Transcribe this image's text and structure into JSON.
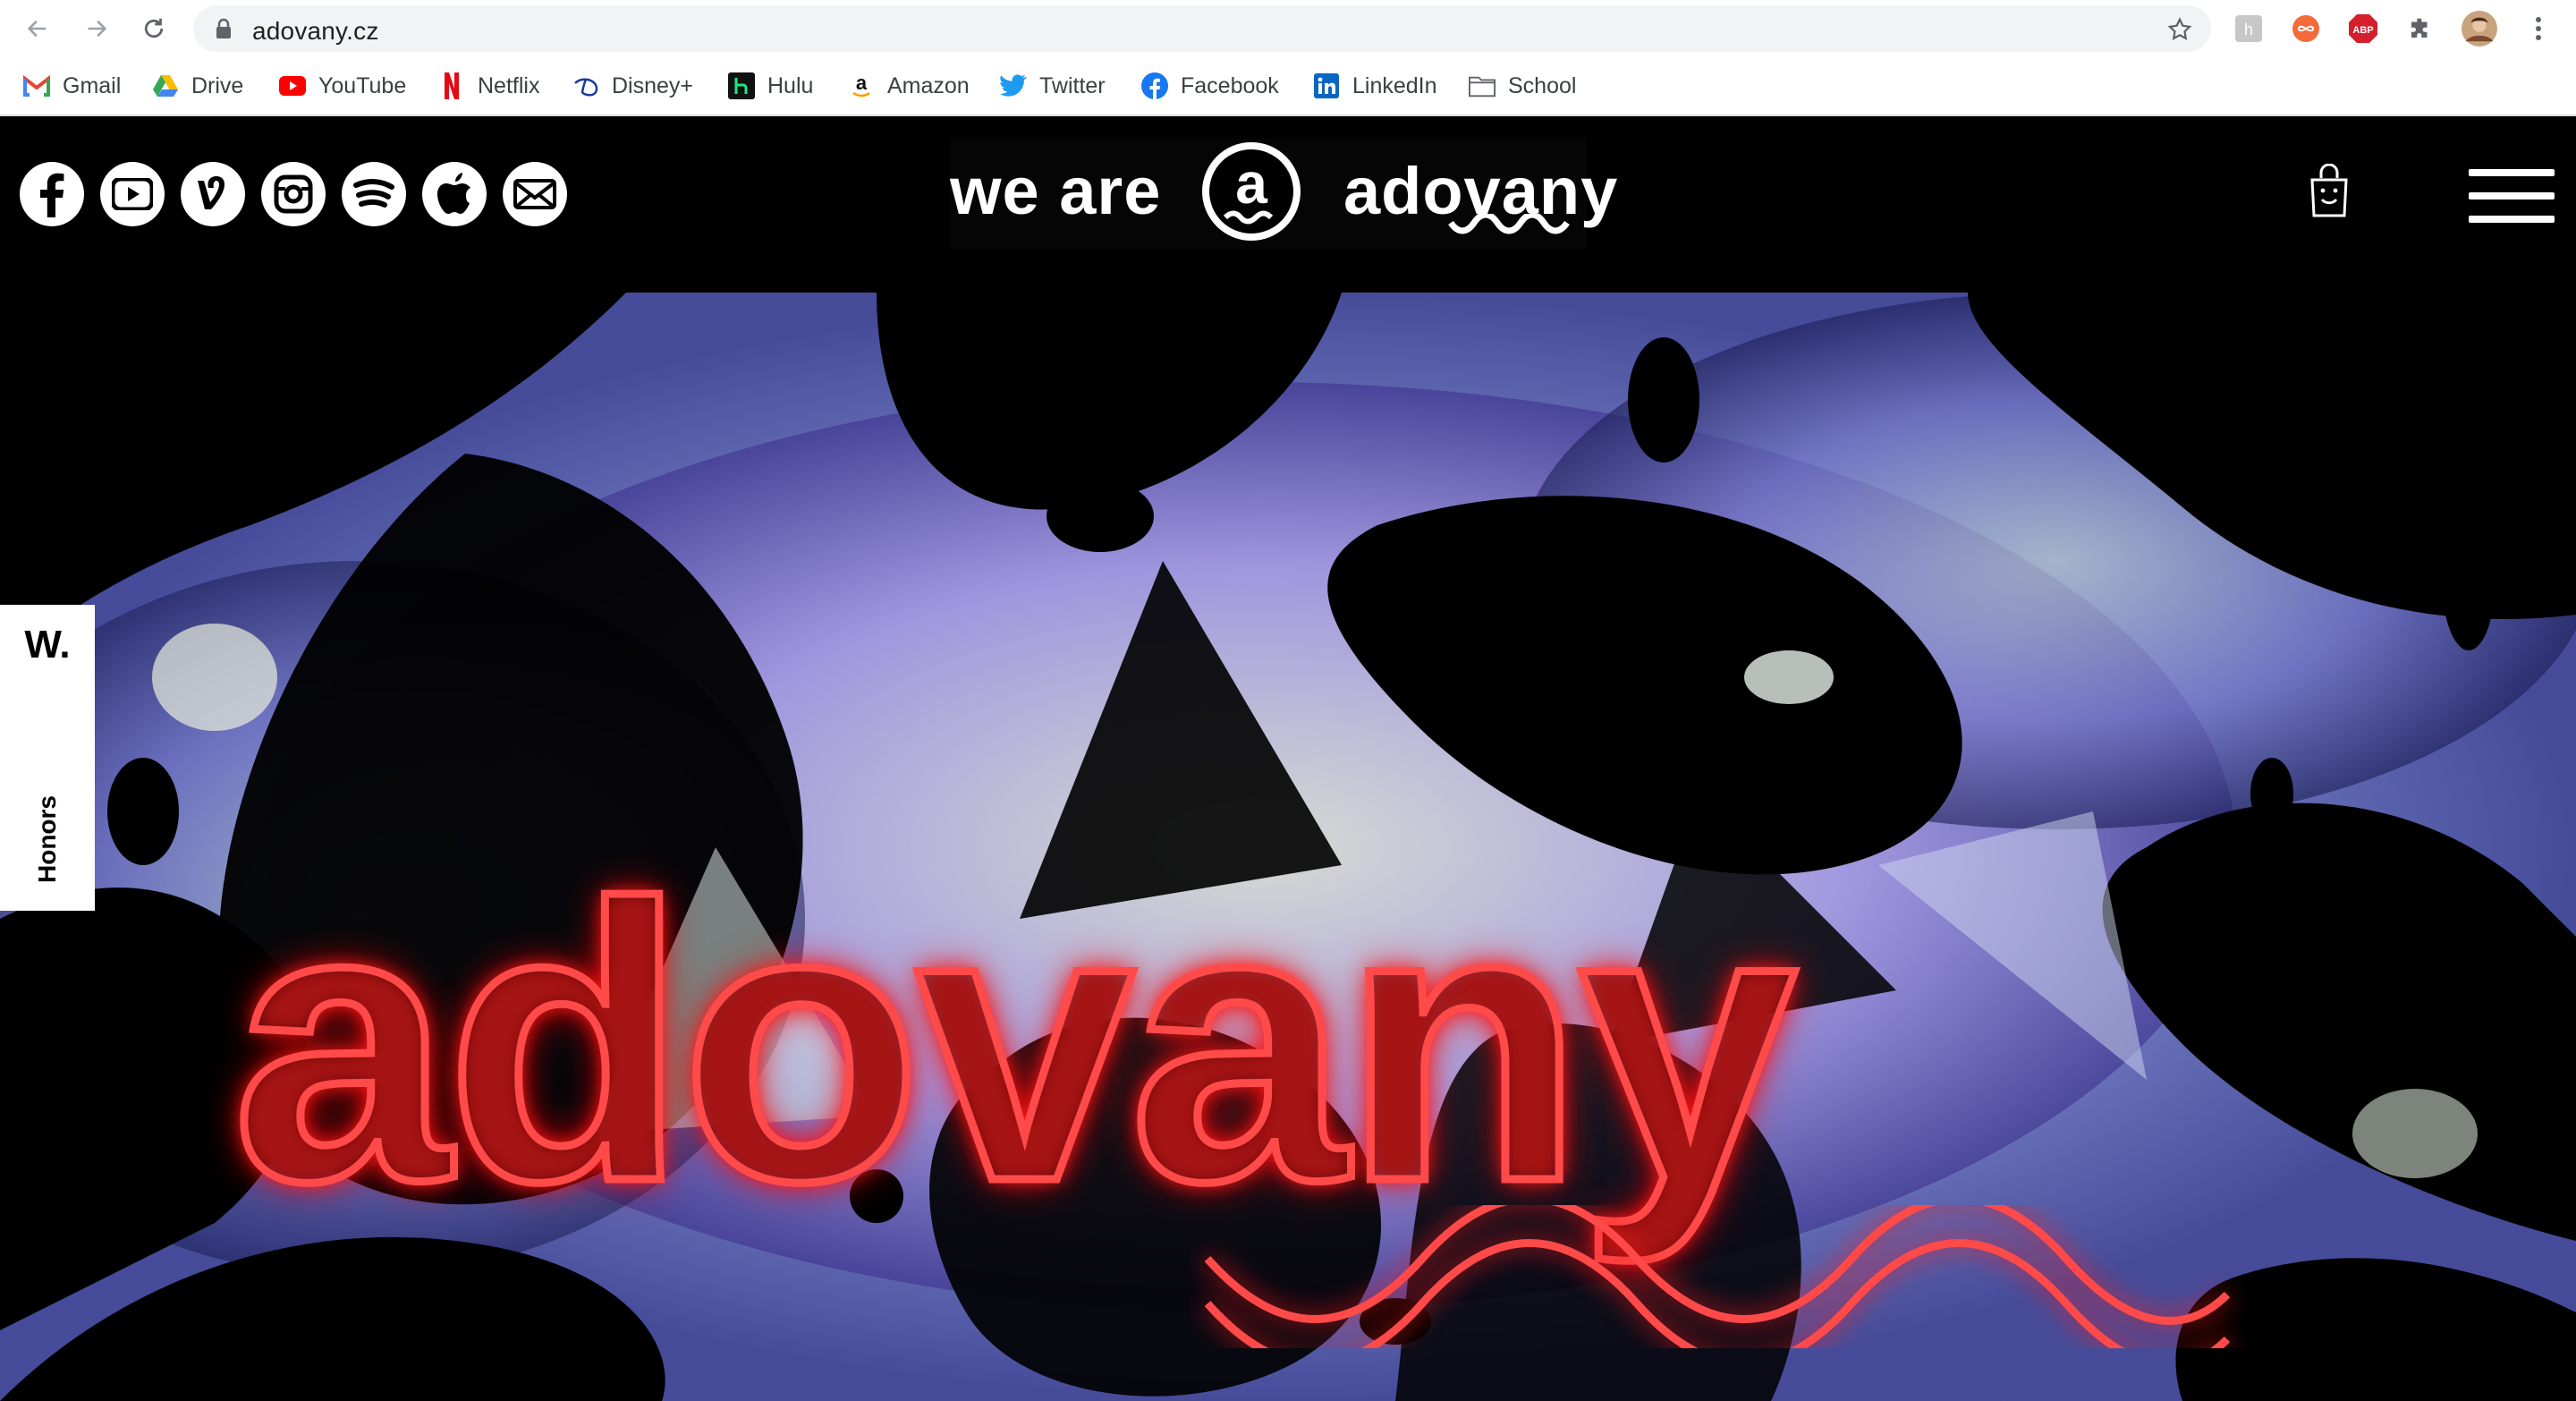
{
  "browser": {
    "url": "adovany.cz",
    "bookmarks": [
      {
        "label": "Gmail"
      },
      {
        "label": "Drive"
      },
      {
        "label": "YouTube"
      },
      {
        "label": "Netflix"
      },
      {
        "label": "Disney+"
      },
      {
        "label": "Hulu"
      },
      {
        "label": "Amazon"
      },
      {
        "label": "Twitter"
      },
      {
        "label": "Facebook"
      },
      {
        "label": "LinkedIn"
      },
      {
        "label": "School"
      }
    ],
    "extensions": [
      "reader-extension-icon",
      "infinity-extension-icon",
      "adblock-plus-icon",
      "extensions-puzzle-icon"
    ]
  },
  "header": {
    "logo_prefix": "we are",
    "logo_name": "adovany",
    "social_icons": [
      "facebook-icon",
      "youtube-icon",
      "vine-icon",
      "instagram-icon",
      "spotify-icon",
      "apple-icon",
      "mail-icon"
    ]
  },
  "hero": {
    "title": "adovany",
    "neon_color": "#ff3b3b"
  },
  "honors_badge": {
    "mark": "W.",
    "label": "Honors"
  },
  "colors": {
    "site_background": "#000000",
    "neon": "#ff3b3b",
    "chrome_background": "#ffffff",
    "omnibox": "#f1f3f4"
  }
}
